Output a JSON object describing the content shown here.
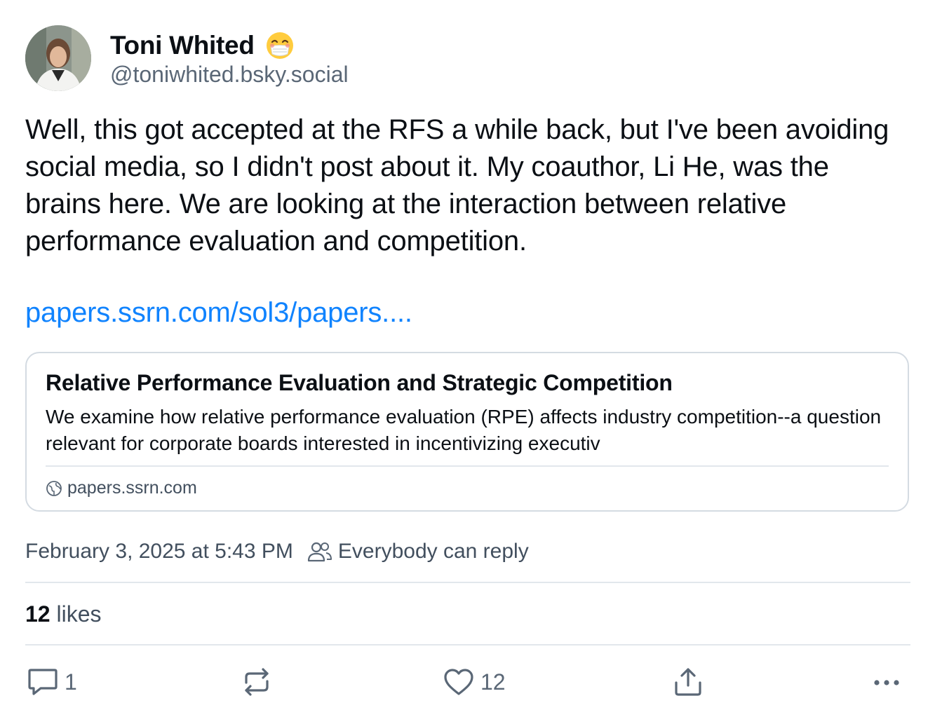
{
  "author": {
    "display_name": "Toni Whited",
    "handle": "@toniwhited.bsky.social",
    "avatar": "avatar",
    "emoji": "face-with-medical-mask-emoji"
  },
  "post": {
    "text": "Well, this got accepted at the RFS a while back, but I've been avoiding social media, so I didn't post about it. My coauthor, Li He, was the brains here. We are looking at the interaction between relative performance evaluation and competition.",
    "link_text": "papers.ssrn.com/sol3/papers...."
  },
  "link_card": {
    "title": "Relative Performance Evaluation and Strategic Competition",
    "description": "We examine how relative performance evaluation (RPE) affects industry competition--a question relevant for corporate boards interested in incentivizing executiv",
    "domain": "papers.ssrn.com",
    "domain_icon": "globe-icon"
  },
  "meta": {
    "timestamp": "February 3, 2025 at 5:43 PM",
    "reply_setting": "Everybody can reply",
    "reply_icon": "people-icon"
  },
  "stats": {
    "likes_count": "12",
    "likes_label": " likes"
  },
  "actions": {
    "reply_count": "1",
    "repost_count": "",
    "like_count": "12"
  },
  "colors": {
    "link": "#1083fe",
    "text": "#0b0f14",
    "secondary": "#5a6776",
    "border": "#d4dbe2"
  }
}
